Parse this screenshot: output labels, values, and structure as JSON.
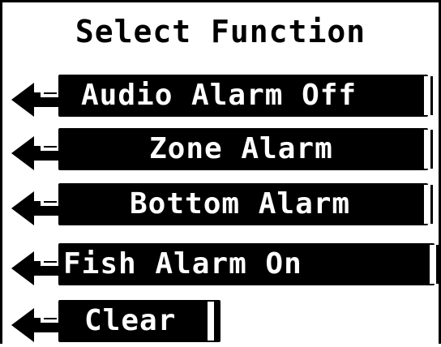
{
  "screen": {
    "title": "Select Function",
    "items": [
      {
        "label": "Audio Alarm Off"
      },
      {
        "label": "Zone Alarm"
      },
      {
        "label": "Bottom Alarm"
      },
      {
        "label": "Fish Alarm On"
      },
      {
        "label": "Clear"
      }
    ]
  },
  "colors": {
    "background": "#ffffff",
    "foreground": "#000000"
  },
  "icons": {
    "menu_arrow": "return-arrow-icon"
  }
}
